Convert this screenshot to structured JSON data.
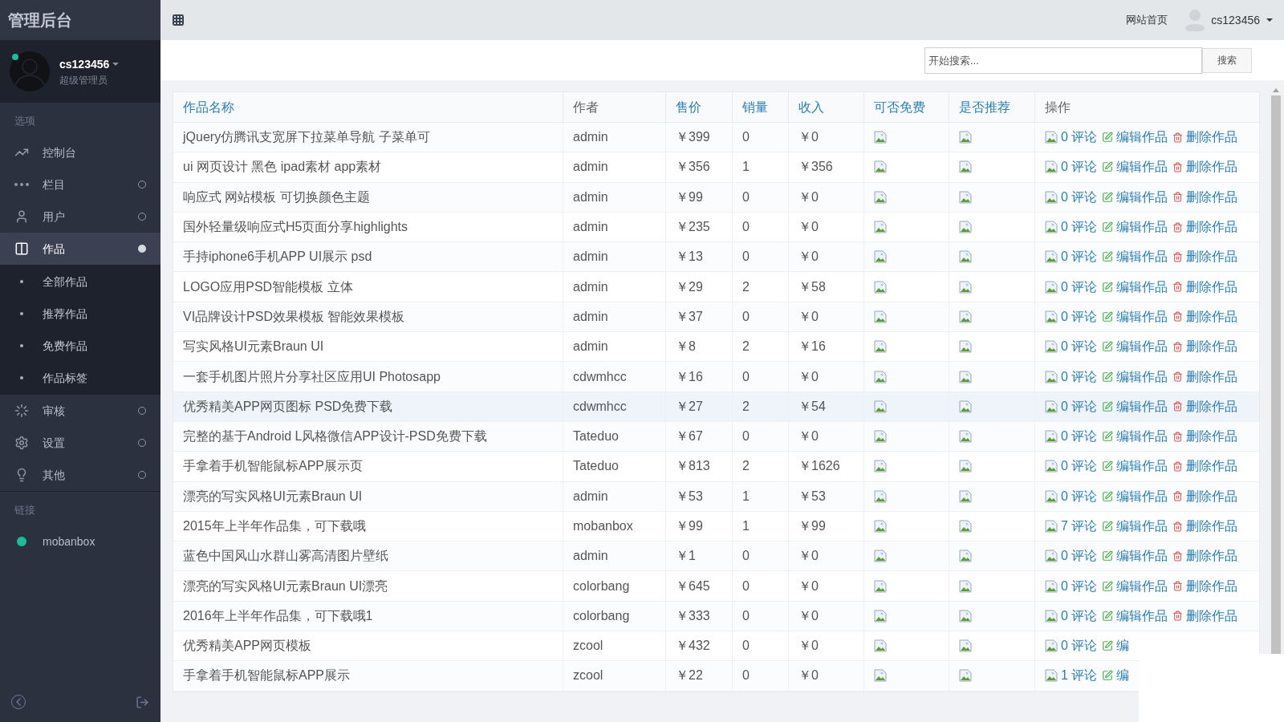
{
  "sidebar": {
    "title": "管理后台",
    "user": {
      "name": "cs123456",
      "role": "超级管理员",
      "online": true
    },
    "sections": [
      {
        "heading": "选项",
        "items": [
          {
            "label": "控制台",
            "selected": false
          },
          {
            "label": "栏目",
            "expanded": false,
            "selected": false
          },
          {
            "label": "用户",
            "expanded": false,
            "selected": false
          },
          {
            "label": "作品",
            "expanded": true,
            "selected": true,
            "children": [
              {
                "label": "全部作品"
              },
              {
                "label": "推荐作品"
              },
              {
                "label": "免费作品"
              },
              {
                "label": "作品标签"
              }
            ]
          },
          {
            "label": "审核",
            "expanded": false,
            "selected": false
          },
          {
            "label": "设置",
            "expanded": false,
            "selected": false
          },
          {
            "label": "其他",
            "expanded": false,
            "selected": false
          }
        ]
      },
      {
        "heading": "链接",
        "items": [
          {
            "label": "mobanbox",
            "color": "#1abc9c"
          }
        ]
      }
    ]
  },
  "header": {
    "home_link": "网站首页",
    "user": "cs123456"
  },
  "search": {
    "placeholder": "开始搜索...",
    "button": "搜索"
  },
  "table": {
    "columns": [
      {
        "label": "作品名称",
        "sortable": true
      },
      {
        "label": "作者",
        "sortable": false
      },
      {
        "label": "售价",
        "sortable": true
      },
      {
        "label": "销量",
        "sortable": true
      },
      {
        "label": "收入",
        "sortable": true
      },
      {
        "label": "可否免费",
        "sortable": true
      },
      {
        "label": "是否推荐",
        "sortable": true
      },
      {
        "label": "操作",
        "sortable": false
      }
    ],
    "rows": [
      {
        "name": "jQuery仿腾讯支宽屏下拉菜单导航 子菜单可",
        "author": "admin",
        "price": "￥399",
        "sales": "0",
        "income": "￥0",
        "comments": "0 评论",
        "edit": "编辑作品",
        "delete": "删除作品",
        "selected": false
      },
      {
        "name": "ui 网页设计 黑色 ipad素材 app素材",
        "author": "admin",
        "price": "￥356",
        "sales": "1",
        "income": "￥356",
        "comments": "0 评论",
        "edit": "编辑作品",
        "delete": "删除作品",
        "selected": false
      },
      {
        "name": "响应式 网站模板 可切换颜色主题",
        "author": "admin",
        "price": "￥99",
        "sales": "0",
        "income": "￥0",
        "comments": "0 评论",
        "edit": "编辑作品",
        "delete": "删除作品",
        "selected": false
      },
      {
        "name": "国外轻量级响应式H5页面分享highlights",
        "author": "admin",
        "price": "￥235",
        "sales": "0",
        "income": "￥0",
        "comments": "0 评论",
        "edit": "编辑作品",
        "delete": "删除作品",
        "selected": false
      },
      {
        "name": "手持iphone6手机APP UI展示 psd",
        "author": "admin",
        "price": "￥13",
        "sales": "0",
        "income": "￥0",
        "comments": "0 评论",
        "edit": "编辑作品",
        "delete": "删除作品",
        "selected": false
      },
      {
        "name": "LOGO应用PSD智能模板 立体",
        "author": "admin",
        "price": "￥29",
        "sales": "2",
        "income": "￥58",
        "comments": "0 评论",
        "edit": "编辑作品",
        "delete": "删除作品",
        "selected": false
      },
      {
        "name": "VI品牌设计PSD效果模板 智能效果模板",
        "author": "admin",
        "price": "￥37",
        "sales": "0",
        "income": "￥0",
        "comments": "0 评论",
        "edit": "编辑作品",
        "delete": "删除作品",
        "selected": false
      },
      {
        "name": "写实风格UI元素Braun UI",
        "author": "admin",
        "price": "￥8",
        "sales": "2",
        "income": "￥16",
        "comments": "0 评论",
        "edit": "编辑作品",
        "delete": "删除作品",
        "selected": false
      },
      {
        "name": "一套手机图片照片分享社区应用UI Photosapp",
        "author": "cdwmhcc",
        "price": "￥16",
        "sales": "0",
        "income": "￥0",
        "comments": "0 评论",
        "edit": "编辑作品",
        "delete": "删除作品",
        "selected": false
      },
      {
        "name": "优秀精美APP网页图标 PSD免费下载",
        "author": "cdwmhcc",
        "price": "￥27",
        "sales": "2",
        "income": "￥54",
        "comments": "0 评论",
        "edit": "编辑作品",
        "delete": "删除作品",
        "selected": true
      },
      {
        "name": "完整的基于Android L风格微信APP设计-PSD免费下载",
        "author": "Tateduo",
        "price": "￥67",
        "sales": "0",
        "income": "￥0",
        "comments": "0 评论",
        "edit": "编辑作品",
        "delete": "删除作品",
        "selected": false
      },
      {
        "name": "手拿着手机智能鼠标APP展示页",
        "author": "Tateduo",
        "price": "￥813",
        "sales": "2",
        "income": "￥1626",
        "comments": "0 评论",
        "edit": "编辑作品",
        "delete": "删除作品",
        "selected": false
      },
      {
        "name": "漂亮的写实风格UI元素Braun UI",
        "author": "admin",
        "price": "￥53",
        "sales": "1",
        "income": "￥53",
        "comments": "0 评论",
        "edit": "编辑作品",
        "delete": "删除作品",
        "selected": false
      },
      {
        "name": "2015年上半年作品集，可下载哦",
        "author": "mobanbox",
        "price": "￥99",
        "sales": "1",
        "income": "￥99",
        "comments": "7 评论",
        "edit": "编辑作品",
        "delete": "删除作品",
        "selected": false
      },
      {
        "name": "蓝色中国风山水群山雾高清图片壁纸",
        "author": "admin",
        "price": "￥1",
        "sales": "0",
        "income": "￥0",
        "comments": "0 评论",
        "edit": "编辑作品",
        "delete": "删除作品",
        "selected": false
      },
      {
        "name": "漂亮的写实风格UI元素Braun UI漂亮",
        "author": "colorbang",
        "price": "￥645",
        "sales": "0",
        "income": "￥0",
        "comments": "0 评论",
        "edit": "编辑作品",
        "delete": "删除作品",
        "selected": false
      },
      {
        "name": "2016年上半年作品集，可下载哦1",
        "author": "colorbang",
        "price": "￥333",
        "sales": "0",
        "income": "￥0",
        "comments": "0 评论",
        "edit": "编辑作品",
        "delete": "删除作品",
        "selected": false
      },
      {
        "name": "优秀精美APP网页模板",
        "author": "zcool",
        "price": "￥432",
        "sales": "0",
        "income": "￥0",
        "comments": "0 评论",
        "edit": "编",
        "selected": false
      },
      {
        "name": "手拿着手机智能鼠标APP展示",
        "author": "zcool",
        "price": "￥22",
        "sales": "0",
        "income": "￥0",
        "comments": "1 评论",
        "edit": "编",
        "selected": false
      }
    ]
  }
}
